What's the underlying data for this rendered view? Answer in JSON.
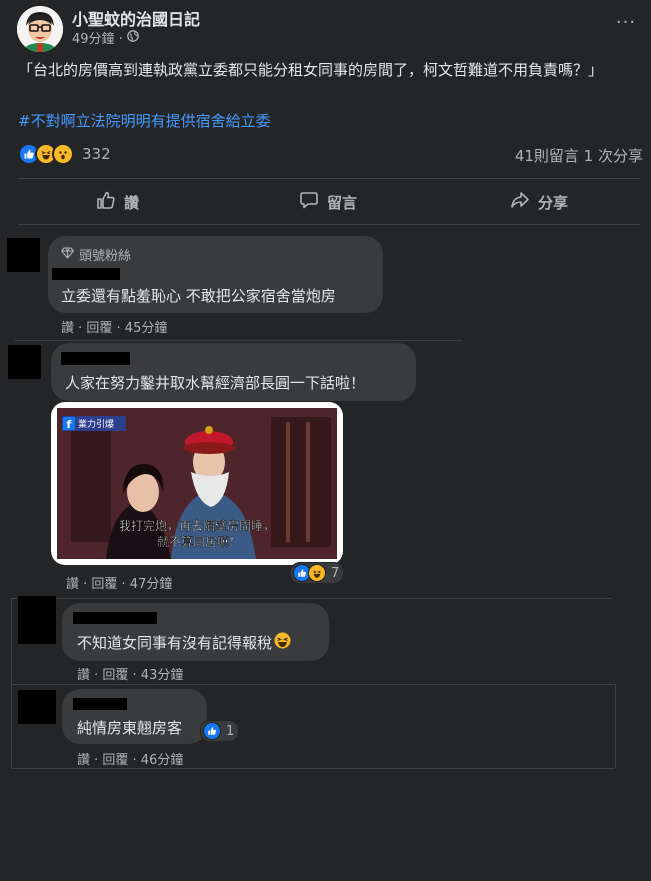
{
  "post": {
    "page_name": "小聖蚊的治國日記",
    "time": "49分鐘 ·",
    "more": "···",
    "text": "「台北的房價高到連執政黨立委都只能分租女同事的房間了，柯文哲難道不用負責嗎？」",
    "hashtag": "#不對啊立法院明明有提供宿舍給立委",
    "reaction_count": "332",
    "stats": "41則留言  1 次分享"
  },
  "actions": {
    "like": "讚",
    "comment": "留言",
    "share": "分享"
  },
  "comments": [
    {
      "badge": "頭號粉絲",
      "text": "立委還有點羞恥心 不敢把公家宿舍當炮房",
      "meta": "讚 · 回覆 · 45分鐘"
    },
    {
      "text": "人家在努力鑿井取水幫經濟部長圓一下話啦！",
      "image": {
        "logo": "業力引爆",
        "subtitle_line1": "我打完炮，再去隔壁房間睡，",
        "subtitle_line2": "就不算同居嘛！"
      },
      "reaction_count": "7",
      "meta": "讚 · 回覆 · 47分鐘"
    },
    {
      "text": "不知道女同事有沒有記得報稅",
      "meta": "讚 · 回覆 · 43分鐘"
    },
    {
      "text": "純情房東翹房客",
      "reaction_count": "1",
      "meta": "讚 · 回覆 · 46分鐘"
    }
  ],
  "colors": {
    "background": "#242526",
    "bubble": "#3a3b3c",
    "link": "#4599ff",
    "like_blue": "#1877f2",
    "haha_yellow": "#f7b928"
  }
}
